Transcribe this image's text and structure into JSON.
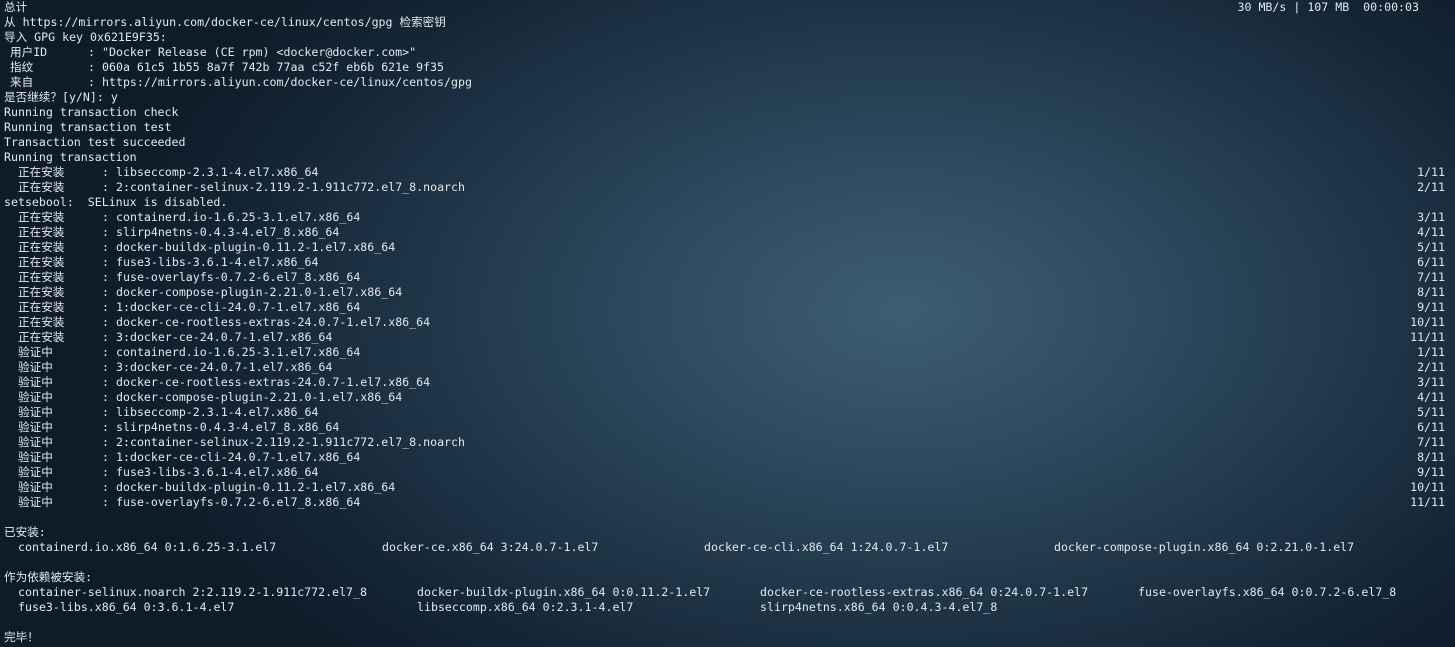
{
  "header": {
    "total": "总计",
    "progress": "30 MB/s | 107 MB  00:00:03"
  },
  "retrieve": "从 https://mirrors.aliyun.com/docker-ce/linux/centos/gpg 检索密钥",
  "import": "导入 GPG key 0x621E9F35:",
  "key_info": [
    {
      "label": "用户ID",
      "value": "\"Docker Release (CE rpm) <docker@docker.com>\""
    },
    {
      "label": "指纹",
      "value": "060a 61c5 1b55 8a7f 742b 77aa c52f eb6b 621e 9f35"
    },
    {
      "label": "来自",
      "value": "https://mirrors.aliyun.com/docker-ce/linux/centos/gpg"
    }
  ],
  "prompt": "是否继续？[y/N]: y",
  "tx_lines": [
    "Running transaction check",
    "Running transaction test",
    "Transaction test succeeded",
    "Running transaction"
  ],
  "install_steps_a": [
    {
      "action": "正在安装",
      "pkg": "libseccomp-2.3.1-4.el7.x86_64",
      "count": "1/11"
    },
    {
      "action": "正在安装",
      "pkg": "2:container-selinux-2.119.2-1.911c772.el7_8.noarch",
      "count": "2/11"
    }
  ],
  "setsebool": "setsebool:  SELinux is disabled.",
  "install_steps_b": [
    {
      "action": "正在安装",
      "pkg": "containerd.io-1.6.25-3.1.el7.x86_64",
      "count": "3/11"
    },
    {
      "action": "正在安装",
      "pkg": "slirp4netns-0.4.3-4.el7_8.x86_64",
      "count": "4/11"
    },
    {
      "action": "正在安装",
      "pkg": "docker-buildx-plugin-0.11.2-1.el7.x86_64",
      "count": "5/11"
    },
    {
      "action": "正在安装",
      "pkg": "fuse3-libs-3.6.1-4.el7.x86_64",
      "count": "6/11"
    },
    {
      "action": "正在安装",
      "pkg": "fuse-overlayfs-0.7.2-6.el7_8.x86_64",
      "count": "7/11"
    },
    {
      "action": "正在安装",
      "pkg": "docker-compose-plugin-2.21.0-1.el7.x86_64",
      "count": "8/11"
    },
    {
      "action": "正在安装",
      "pkg": "1:docker-ce-cli-24.0.7-1.el7.x86_64",
      "count": "9/11"
    },
    {
      "action": "正在安装",
      "pkg": "docker-ce-rootless-extras-24.0.7-1.el7.x86_64",
      "count": "10/11"
    },
    {
      "action": "正在安装",
      "pkg": "3:docker-ce-24.0.7-1.el7.x86_64",
      "count": "11/11"
    },
    {
      "action": "验证中",
      "pkg": "containerd.io-1.6.25-3.1.el7.x86_64",
      "count": "1/11"
    },
    {
      "action": "验证中",
      "pkg": "3:docker-ce-24.0.7-1.el7.x86_64",
      "count": "2/11"
    },
    {
      "action": "验证中",
      "pkg": "docker-ce-rootless-extras-24.0.7-1.el7.x86_64",
      "count": "3/11"
    },
    {
      "action": "验证中",
      "pkg": "docker-compose-plugin-2.21.0-1.el7.x86_64",
      "count": "4/11"
    },
    {
      "action": "验证中",
      "pkg": "libseccomp-2.3.1-4.el7.x86_64",
      "count": "5/11"
    },
    {
      "action": "验证中",
      "pkg": "slirp4netns-0.4.3-4.el7_8.x86_64",
      "count": "6/11"
    },
    {
      "action": "验证中",
      "pkg": "2:container-selinux-2.119.2-1.911c772.el7_8.noarch",
      "count": "7/11"
    },
    {
      "action": "验证中",
      "pkg": "1:docker-ce-cli-24.0.7-1.el7.x86_64",
      "count": "8/11"
    },
    {
      "action": "验证中",
      "pkg": "fuse3-libs-3.6.1-4.el7.x86_64",
      "count": "9/11"
    },
    {
      "action": "验证中",
      "pkg": "docker-buildx-plugin-0.11.2-1.el7.x86_64",
      "count": "10/11"
    },
    {
      "action": "验证中",
      "pkg": "fuse-overlayfs-0.7.2-6.el7_8.x86_64",
      "count": "11/11"
    }
  ],
  "installed_header": "已安装:",
  "installed": [
    "containerd.io.x86_64 0:1.6.25-3.1.el7",
    "docker-ce.x86_64 3:24.0.7-1.el7",
    "docker-ce-cli.x86_64 1:24.0.7-1.el7",
    "docker-compose-plugin.x86_64 0:2.21.0-1.el7"
  ],
  "deps_header": "作为依赖被安装:",
  "deps_row1": [
    "container-selinux.noarch 2:2.119.2-1.911c772.el7_8",
    "docker-buildx-plugin.x86_64 0:0.11.2-1.el7",
    "docker-ce-rootless-extras.x86_64 0:24.0.7-1.el7",
    "fuse-overlayfs.x86_64 0:0.7.2-6.el7_8"
  ],
  "deps_row2": [
    "fuse3-libs.x86_64 0:3.6.1-4.el7",
    "libseccomp.x86_64 0:2.3.1-4.el7",
    "slirp4netns.x86_64 0:0.4.3-4.el7_8"
  ],
  "done": "完毕！",
  "colors": {
    "text": "#e3e8ec",
    "bg_center": "#3d5d74",
    "bg_edge": "#0e1c29"
  }
}
